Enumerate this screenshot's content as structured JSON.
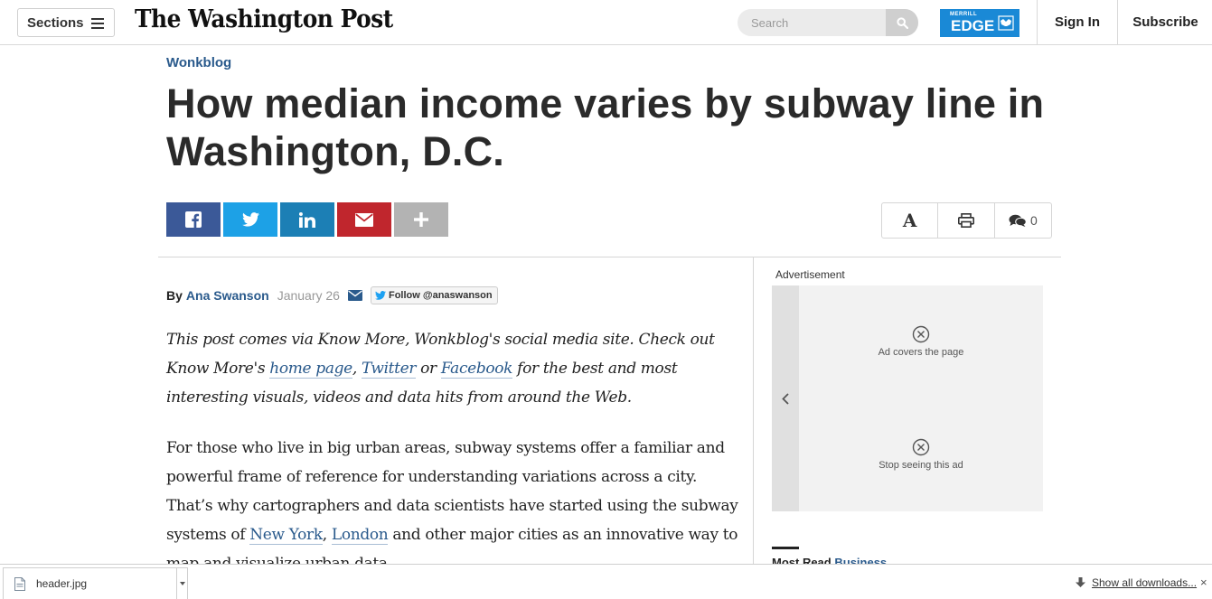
{
  "header": {
    "sections_label": "Sections",
    "logo_text": "The Washington Post",
    "search_placeholder": "Search",
    "ad_brand_small": "MERRILL",
    "ad_brand_large": "EDGE",
    "signin_label": "Sign In",
    "subscribe_label": "Subscribe"
  },
  "article": {
    "kicker": "Wonkblog",
    "headline": "How median income varies by subway line in Washington, D.C.",
    "byline_prefix": "By",
    "author": "Ana Swanson",
    "date": "January 26",
    "follow_label": "Follow @anaswanson",
    "intro": {
      "part1": "This post comes via Know More, Wonkblog's social media site. Check out Know More's ",
      "link1": "home page",
      "sep1": ", ",
      "link2": "Twitter",
      "sep2": " or ",
      "link3": "Facebook",
      "part2": " for the best and most interesting visuals, videos and data hits from around the Web."
    },
    "body": {
      "part1": "For those who live in big urban areas, subway systems offer a familiar and powerful frame of reference for understanding variations across a city. That’s why cartographers and data scientists have started using the subway systems of ",
      "link1": "New York",
      "sep1": ", ",
      "link2": "London",
      "part2": " and other major cities as an innovative way to map and visualize urban data."
    }
  },
  "share": {
    "colors": {
      "facebook": "#3b5998",
      "twitter": "#1da1e6",
      "linkedin": "#1c7fb5",
      "email": "#c0262d",
      "more": "#b3b3b3"
    },
    "icons": [
      "facebook-icon",
      "twitter-icon",
      "linkedin-icon",
      "email-icon",
      "plus-icon"
    ]
  },
  "tools": {
    "font_label": "A",
    "comment_count": "0"
  },
  "ad": {
    "label": "Advertisement",
    "option1": "Ad covers the page",
    "option2": "Stop seeing this ad"
  },
  "most_read": {
    "prefix": "Most Read",
    "section": "Business"
  },
  "downloads": {
    "filename": "header.jpg",
    "show_all": "Show all downloads...",
    "close": "×"
  }
}
